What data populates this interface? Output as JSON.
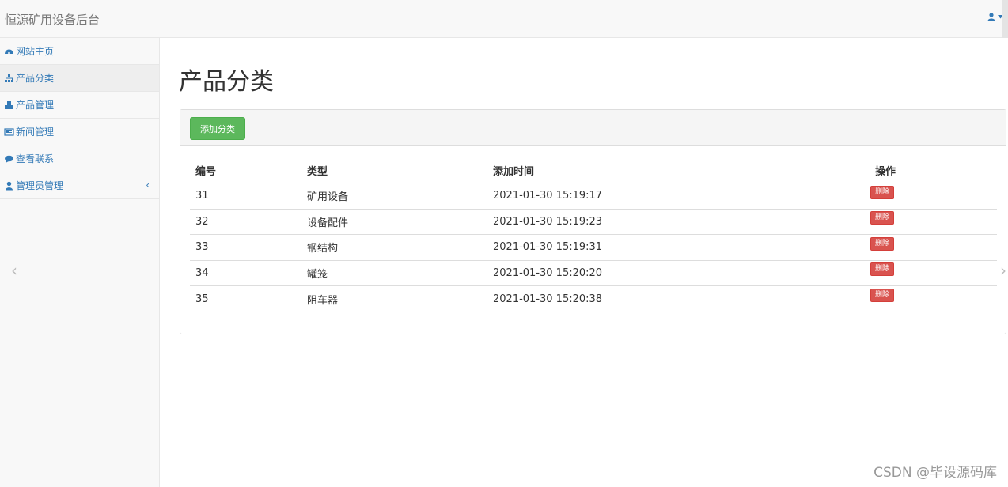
{
  "header": {
    "brand": "恒源矿用设备后台"
  },
  "sidebar": {
    "items": [
      {
        "label": "网站主页",
        "icon": "dashboard-icon"
      },
      {
        "label": "产品分类",
        "icon": "sitemap-icon"
      },
      {
        "label": "产品管理",
        "icon": "cubes-icon"
      },
      {
        "label": "新闻管理",
        "icon": "newspaper-icon"
      },
      {
        "label": "查看联系",
        "icon": "comment-icon"
      },
      {
        "label": "管理员管理",
        "icon": "user-icon",
        "chevron": "‹"
      }
    ],
    "active_index": 1
  },
  "main": {
    "title": "产品分类",
    "add_button": "添加分类",
    "table": {
      "headers": [
        "编号",
        "类型",
        "添加时间",
        "操作"
      ],
      "rows": [
        {
          "id": "31",
          "type": "矿用设备",
          "time": "2021-01-30 15:19:17",
          "action": "删除"
        },
        {
          "id": "32",
          "type": "设备配件",
          "time": "2021-01-30 15:19:23",
          "action": "删除"
        },
        {
          "id": "33",
          "type": "钢结构",
          "time": "2021-01-30 15:19:31",
          "action": "删除"
        },
        {
          "id": "34",
          "type": "罐笼",
          "time": "2021-01-30 15:20:20",
          "action": "删除"
        },
        {
          "id": "35",
          "type": "阻车器",
          "time": "2021-01-30 15:20:38",
          "action": "删除"
        }
      ]
    }
  },
  "arrows": {
    "left": "‹",
    "right": "›"
  },
  "watermark": "CSDN @毕设源码库",
  "colors": {
    "accent": "#337ab7",
    "success": "#5cb85c",
    "danger": "#d9534f"
  }
}
